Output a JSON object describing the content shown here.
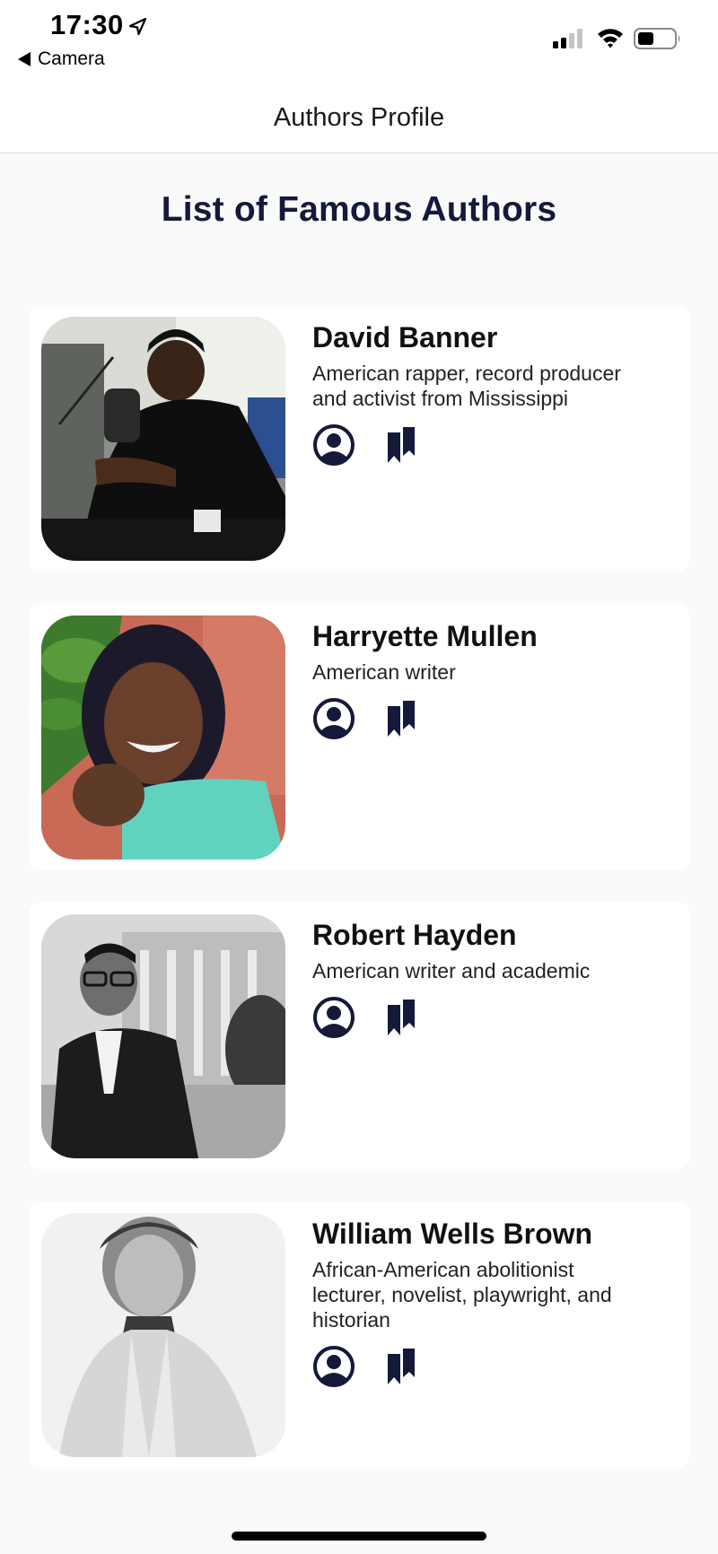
{
  "status_bar": {
    "time": "17:30",
    "back_label": "Camera",
    "icons": [
      "location-arrow-icon",
      "cellular-signal-icon",
      "wifi-icon",
      "battery-icon"
    ]
  },
  "nav": {
    "title": "Authors Profile"
  },
  "main": {
    "title": "List of Famous Authors",
    "authors": [
      {
        "name": "David Banner",
        "description_lines": [
          "American rapper, record producer",
          "and activist from Mississippi"
        ],
        "photo": "photo-david-banner"
      },
      {
        "name": "Harryette Mullen",
        "description_lines": [
          "American writer"
        ],
        "photo": "photo-harryette-mullen"
      },
      {
        "name": "Robert Hayden",
        "description_lines": [
          "American writer and academic"
        ],
        "photo": "photo-robert-hayden"
      },
      {
        "name": "William Wells Brown",
        "description_lines": [
          "African-American abolitionist",
          "lecturer, novelist, playwright, and",
          "historian"
        ],
        "photo": "photo-william-wells-brown"
      }
    ],
    "action_icons": [
      "profile-icon",
      "bookmark-icon"
    ]
  },
  "colors": {
    "accent": "#15193a",
    "background": "#fafafa",
    "card": "#ffffff"
  }
}
